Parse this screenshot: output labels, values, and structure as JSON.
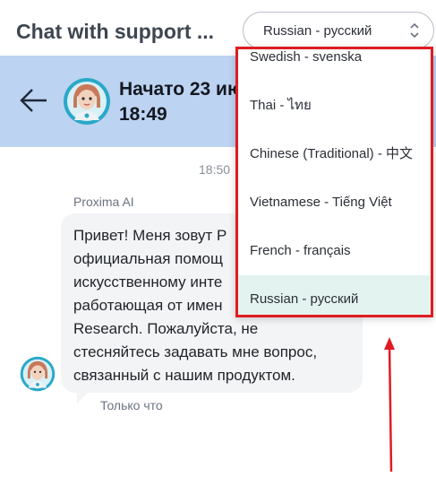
{
  "header": {
    "title": "Chat with support ...",
    "language_select": {
      "value": "Russian - русский"
    }
  },
  "chat_header": {
    "title_line1": "Начато 23 ию",
    "title_line2": "18:49"
  },
  "conversation": {
    "timestamp": "18:50",
    "sender": "Proxima AI",
    "message_lines": [
      "Привет! Меня зовут Р",
      "официальная помощ",
      "искусственному инте",
      "работающая от имен",
      "Research. Пожалуйста, не",
      "стесняйтесь задавать мне вопрос,",
      "связанный с нашим продуктом."
    ],
    "sent_ago": "Только что"
  },
  "language_dropdown": {
    "options": [
      {
        "label": "Swedish - svenska",
        "selected": false
      },
      {
        "label": "Thai - ไทย",
        "selected": false
      },
      {
        "label": "Chinese (Traditional) - 中文",
        "selected": false
      },
      {
        "label": "Vietnamese - Tiếng Việt",
        "selected": false
      },
      {
        "label": "French - français",
        "selected": false
      },
      {
        "label": "Russian - русский",
        "selected": true
      }
    ],
    "highlight_color": "#e01b22",
    "selected_bg": "#e3f3ef"
  },
  "annotation": {
    "arrow_color": "#e01b22"
  },
  "icons": {
    "back": "arrow-left-icon",
    "chevron": "chevron-updown-icon",
    "avatar": "bot-avatar-icon"
  },
  "colors": {
    "header_bg": "#bcd3f2",
    "bubble_bg": "#f3f4f6"
  }
}
